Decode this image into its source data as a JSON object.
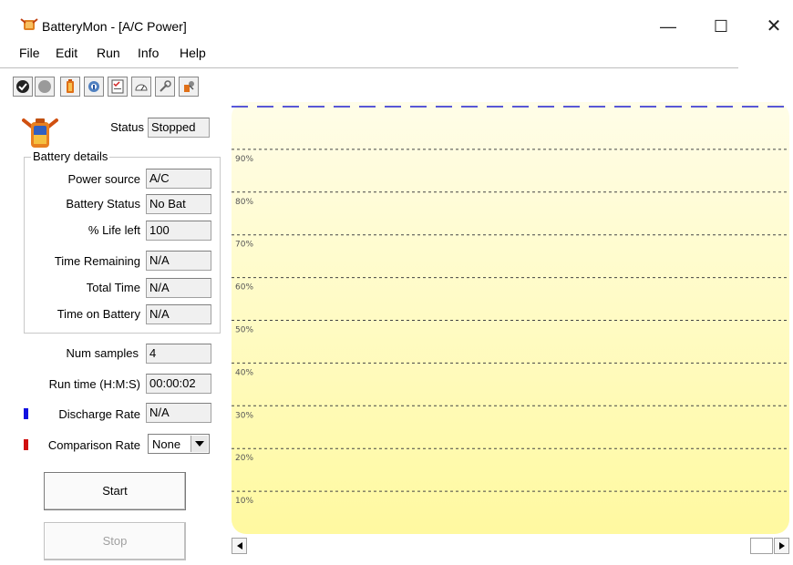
{
  "window": {
    "title": "BatteryMon - [A/C Power]",
    "minimize_label": "—",
    "maximize_label": "☐",
    "close_label": "✕"
  },
  "menu": [
    {
      "label": "File"
    },
    {
      "label": "Edit"
    },
    {
      "label": "Run"
    },
    {
      "label": "Info"
    },
    {
      "label": "Help"
    }
  ],
  "toolbar": [
    {
      "icon": "check-icon"
    },
    {
      "icon": "stop-circle-icon"
    },
    {
      "icon": "battery-icon"
    },
    {
      "icon": "info-gear-icon"
    },
    {
      "icon": "checklist-icon"
    },
    {
      "icon": "gauge-icon"
    },
    {
      "icon": "wrench-icon"
    },
    {
      "icon": "settings-icon"
    }
  ],
  "panel": {
    "status_label": "Status",
    "status_value": "Stopped",
    "group_title": "Battery details",
    "power_source_label": "Power source",
    "power_source_value": "A/C",
    "battery_status_label": "Battery Status",
    "battery_status_value": "No Bat",
    "life_left_label": "% Life left",
    "life_left_value": "100",
    "time_remaining_label": "Time Remaining",
    "time_remaining_value": "N/A",
    "total_time_label": "Total Time",
    "total_time_value": "N/A",
    "time_on_battery_label": "Time on Battery",
    "time_on_battery_value": "N/A",
    "num_samples_label": "Num samples",
    "num_samples_value": "4",
    "run_time_label": "Run time (H:M:S)",
    "run_time_value": "00:00:02",
    "discharge_rate_label": "Discharge Rate",
    "discharge_rate_value": "N/A",
    "comparison_rate_label": "Comparison Rate",
    "comparison_rate_value": "None",
    "start_label": "Start",
    "stop_label": "Stop"
  },
  "colors": {
    "discharge": "#1010e0",
    "comparison": "#d01010",
    "series_line": "#2020d0"
  },
  "chart_data": {
    "type": "line",
    "ylim": [
      0,
      100
    ],
    "yticks": [
      "90%",
      "80%",
      "70%",
      "60%",
      "50%",
      "40%",
      "30%",
      "20%",
      "10%"
    ],
    "series": [
      {
        "values": [
          100,
          100,
          100,
          100,
          100,
          100,
          100,
          100,
          100,
          100,
          100,
          100,
          100,
          100,
          100,
          100,
          100,
          100,
          100,
          100,
          100,
          100,
          100
        ]
      }
    ],
    "grid": true
  }
}
